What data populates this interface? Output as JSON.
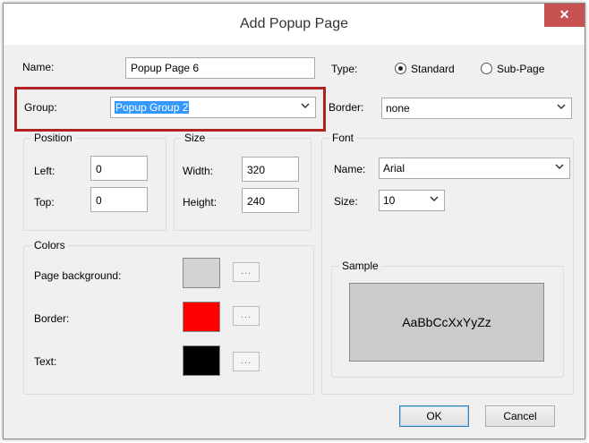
{
  "dialog": {
    "title": "Add Popup Page",
    "close_glyph": "✕"
  },
  "name": {
    "label": "Name:",
    "value": "Popup Page 6"
  },
  "type": {
    "label": "Type:",
    "options": [
      {
        "label": "Standard",
        "selected": true
      },
      {
        "label": "Sub-Page",
        "selected": false
      }
    ]
  },
  "group": {
    "label": "Group:",
    "value": "Popup Group 2",
    "highlight_color": "#b22222"
  },
  "border_field": {
    "label": "Border:",
    "value": "none"
  },
  "position": {
    "caption": "Position",
    "left_label": "Left:",
    "left_value": "0",
    "top_label": "Top:",
    "top_value": "0"
  },
  "size": {
    "caption": "Size",
    "width_label": "Width:",
    "width_value": "320",
    "height_label": "Height:",
    "height_value": "240"
  },
  "font": {
    "caption": "Font",
    "name_label": "Name:",
    "name_value": "Arial",
    "size_label": "Size:",
    "size_value": "10"
  },
  "colors": {
    "caption": "Colors",
    "page_background": {
      "label": "Page background:",
      "color": "#d3d3d3"
    },
    "border": {
      "label": "Border:",
      "color": "#ff0000"
    },
    "text": {
      "label": "Text:",
      "color": "#000000"
    },
    "browse_label": "..."
  },
  "sample": {
    "caption": "Sample",
    "text": "AaBbCcXxYyZz"
  },
  "buttons": {
    "ok": "OK",
    "cancel": "Cancel"
  }
}
